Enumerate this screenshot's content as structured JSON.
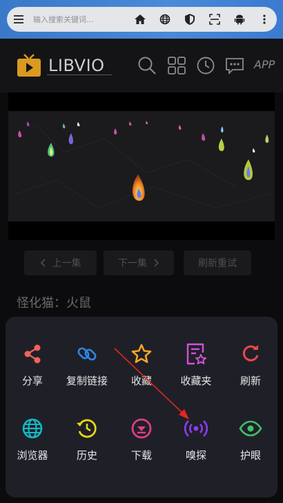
{
  "browser": {
    "url_placeholder": "输入搜索关键词..."
  },
  "site": {
    "logo_text": "LIBVIO",
    "app_label": "APP"
  },
  "episode": {
    "prev_label": "上一集",
    "next_label": "下一集",
    "refresh_label": "刷新重试"
  },
  "video": {
    "title": "怪化猫：火鼠"
  },
  "menu": {
    "items": [
      {
        "label": "分享",
        "icon": "share-icon",
        "color": "#f0625a"
      },
      {
        "label": "复制链接",
        "icon": "link-icon",
        "color": "#2f86e8"
      },
      {
        "label": "收藏",
        "icon": "star-icon",
        "color": "#f5a623"
      },
      {
        "label": "收藏夹",
        "icon": "favorites-folder-icon",
        "color": "#d052d6"
      },
      {
        "label": "刷新",
        "icon": "refresh-icon",
        "color": "#f0454d"
      },
      {
        "label": "浏览器",
        "icon": "globe-icon",
        "color": "#14b8c4"
      },
      {
        "label": "历史",
        "icon": "history-icon",
        "color": "#e8d61a"
      },
      {
        "label": "下载",
        "icon": "download-icon",
        "color": "#e23c8a"
      },
      {
        "label": "嗅探",
        "icon": "sniff-icon",
        "color": "#8b3cf0"
      },
      {
        "label": "护眼",
        "icon": "eye-icon",
        "color": "#3fbf6a"
      }
    ]
  },
  "annotation_color": "#e8251f"
}
